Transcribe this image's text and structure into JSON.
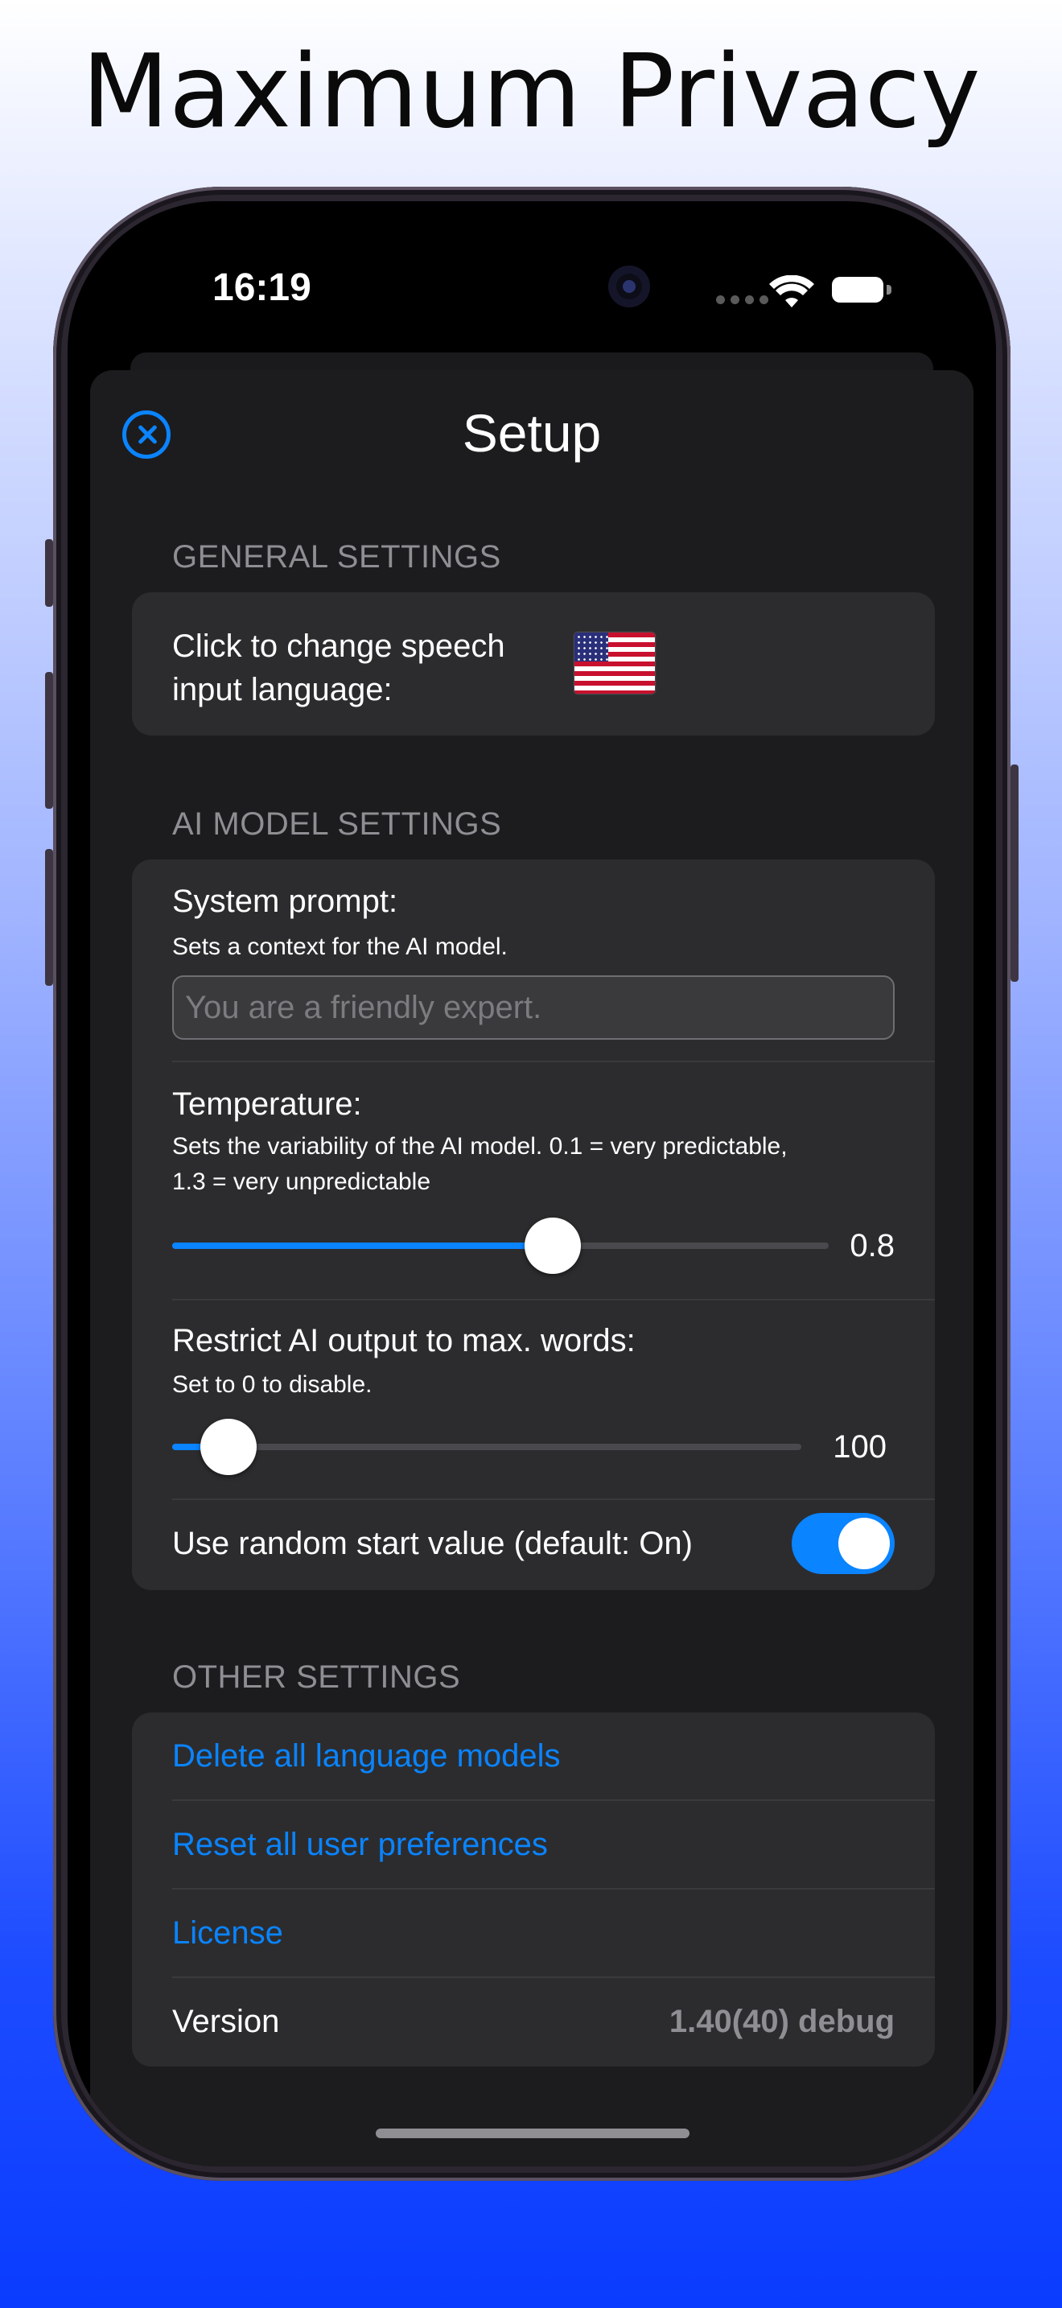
{
  "headline": "Maximum Privacy",
  "status_bar": {
    "time": "16:19"
  },
  "sheet": {
    "title": "Setup"
  },
  "general": {
    "header": "GENERAL SETTINGS",
    "speech_label_line1": "Click to change speech",
    "speech_label_line2": "input language:"
  },
  "ai_model": {
    "header": "AI MODEL SETTINGS",
    "system_prompt_label": "System prompt:",
    "system_prompt_sub": "Sets a context for the AI model.",
    "system_prompt_placeholder": "You are a friendly expert.",
    "temperature_label": "Temperature:",
    "temperature_sub_line1": "Sets the variability of the AI model. 0.1 = very predictable,",
    "temperature_sub_line2": "1.3 = very unpredictable",
    "temperature_value": "0.8",
    "temperature_fraction": 0.58,
    "max_words_label": "Restrict AI output to max. words:",
    "max_words_sub": "Set to 0 to disable.",
    "max_words_value": "100",
    "max_words_fraction": 0.09,
    "random_start_label": "Use random start value (default: On)",
    "random_start_on": true
  },
  "other": {
    "header": "OTHER SETTINGS",
    "delete_models": "Delete all language models",
    "reset_prefs": "Reset all user preferences",
    "license": "License",
    "version_label": "Version",
    "version_value": "1.40(40) debug"
  },
  "icons": {
    "close": "close-circle-icon",
    "flag": "us-flag-icon",
    "wifi": "wifi-icon",
    "battery": "battery-icon"
  },
  "colors": {
    "accent": "#0a84ff",
    "sheet_bg": "#1c1c1e",
    "group_bg": "#2c2c2e"
  }
}
